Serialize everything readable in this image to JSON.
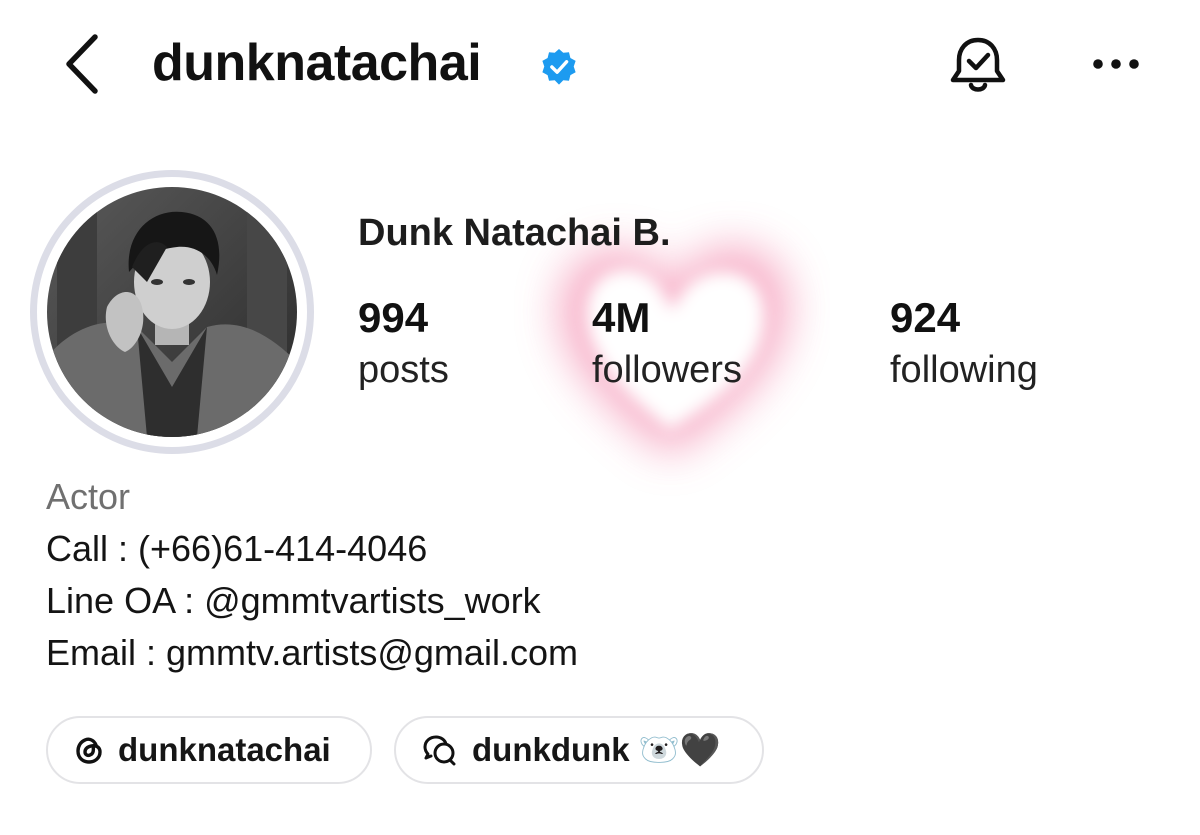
{
  "header": {
    "username": "dunknatachai",
    "verified": true,
    "icons": {
      "back": "chevron-left-icon",
      "verified": "verified-badge-icon",
      "notifications": "bell-check-icon",
      "more": "more-horizontal-icon"
    }
  },
  "profile": {
    "display_name": "Dunk Natachai B.",
    "avatar": "profile-photo",
    "decoration": "pink-heart-glow"
  },
  "stats": [
    {
      "value": "994",
      "label": "posts"
    },
    {
      "value": "4M",
      "label": "followers"
    },
    {
      "value": "924",
      "label": "following"
    }
  ],
  "bio": {
    "category": "Actor",
    "lines": [
      "Call : (+66)61-414-4046",
      "Line OA : @gmmtvartists_work",
      "Email : gmmtv.artists@gmail.com"
    ]
  },
  "chips": [
    {
      "label": "dunknatachai",
      "icon": "threads-icon"
    },
    {
      "label": "dunkdunk 🐻‍❄️🖤",
      "icon": "chat-bubbles-icon"
    }
  ],
  "colors": {
    "verified": "#1d9bf0",
    "heart_glow": "#f48fb1",
    "avatar_ring": "#dcdde7",
    "chip_border": "#e3e3e6",
    "category_text": "#707070"
  }
}
